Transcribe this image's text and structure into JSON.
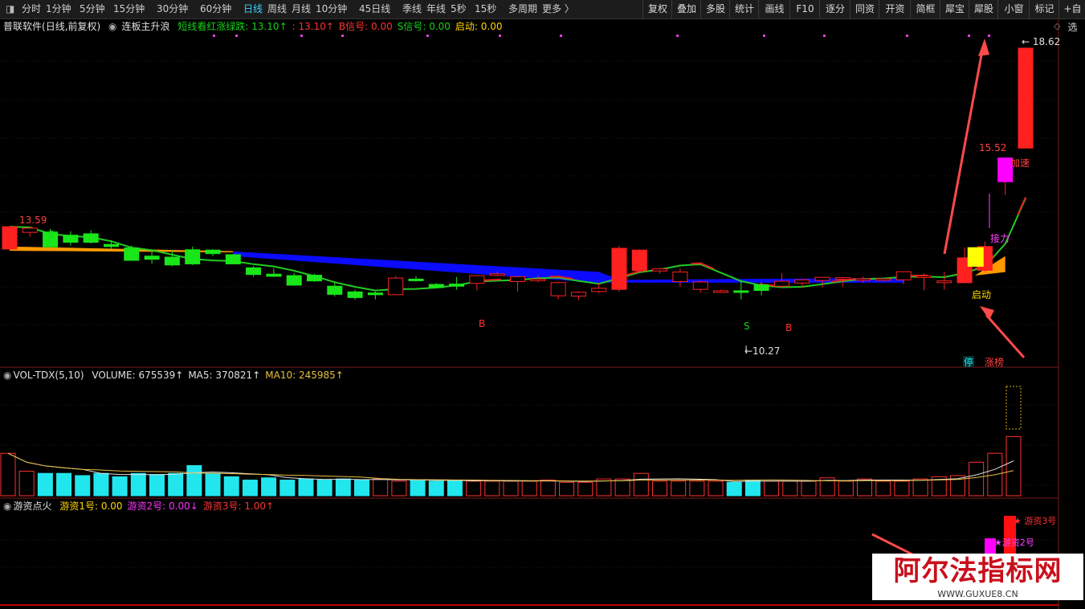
{
  "toolbar": {
    "periods": [
      "分时",
      "1分钟",
      "5分钟",
      "15分钟",
      "30分钟",
      "60分钟",
      "日线",
      "周线",
      "月线",
      "10分钟",
      "45日线",
      "季线",
      "年线",
      "5秒",
      "15秒",
      "多周期",
      "更多 〉"
    ],
    "active_period": "日线",
    "actions": [
      "复权",
      "叠加",
      "多股",
      "统计",
      "画线",
      "F10",
      "逐分",
      "同资",
      "开资",
      "简框",
      "犀宝",
      "犀股",
      "小窗",
      "标记",
      "+自选"
    ]
  },
  "main_panel": {
    "stock_name": "普联软件",
    "period_label": "(日线,前复权)",
    "indicator_name": "连板主升浪",
    "legend": [
      {
        "label": "短线看红涨绿跌:",
        "value": "13.10",
        "arrow": "↑",
        "color": "#19d219"
      },
      {
        "label": ":",
        "value": "13.10",
        "arrow": "↑",
        "color": "#ff3232"
      },
      {
        "label": "B信号:",
        "value": "0.00",
        "arrow": "",
        "color": "#ff3232"
      },
      {
        "label": "S信号:",
        "value": "0.00",
        "arrow": "",
        "color": "#19d219"
      },
      {
        "label": "启动:",
        "value": "0.00",
        "arrow": "",
        "color": "#ffd700"
      }
    ],
    "price_labels": {
      "high": "18.62",
      "mid": "15.52",
      "left": "13.59",
      "low": "10.27"
    },
    "annotations": {
      "jiasu": "加速",
      "jieli": "接力",
      "qidong": "启动",
      "ting": "停",
      "zhangbang": "涨榜",
      "buy": "B",
      "sell": "S"
    }
  },
  "volume_panel": {
    "name": "VOL-TDX(5,10)",
    "legend": [
      {
        "label": "VOLUME:",
        "value": "675539",
        "arrow": "↑",
        "color": "#e0e0e0"
      },
      {
        "label": "MA5:",
        "value": "370821",
        "arrow": "↑",
        "color": "#e0e0e0"
      },
      {
        "label": "MA10:",
        "value": "245985",
        "arrow": "↑",
        "color": "#e8c040"
      }
    ]
  },
  "youzi_panel": {
    "name": "游资点火",
    "legend": [
      {
        "label": "游资1号:",
        "value": "0.00",
        "arrow": "",
        "color": "#ffd700"
      },
      {
        "label": "游资2号:",
        "value": "0.00",
        "arrow": "↓",
        "color": "#ff33ff"
      },
      {
        "label": "游资3号:",
        "value": "1.00",
        "arrow": "↑",
        "color": "#ff3232"
      }
    ],
    "labels": {
      "youzi3": "★ 游资3号",
      "youzi2": "★游资2号"
    }
  },
  "watermark": {
    "main": "阿尔法指标网",
    "url": "WWW.GUXUE8.CN"
  },
  "colors": {
    "up": "#ff2020",
    "down": "#19e619",
    "ma_short": "#22cc22",
    "band_blue": "#0b0bff",
    "band_orange": "#ff9a00",
    "volume_down": "#22e6ee",
    "limit_up": "#ff00ff"
  },
  "chart_data": {
    "type": "candlestick",
    "candles": [
      {
        "o": 12.95,
        "h": 13.59,
        "l": 12.92,
        "c": 13.58
      },
      {
        "o": 13.42,
        "h": 13.59,
        "l": 13.3,
        "c": 13.54
      },
      {
        "o": 13.43,
        "h": 13.52,
        "l": 13.0,
        "c": 13.01
      },
      {
        "o": 13.34,
        "h": 13.45,
        "l": 13.05,
        "c": 13.14
      },
      {
        "o": 13.38,
        "h": 13.48,
        "l": 13.1,
        "c": 13.14
      },
      {
        "o": 13.08,
        "h": 13.2,
        "l": 12.95,
        "c": 13.02
      },
      {
        "o": 12.98,
        "h": 13.05,
        "l": 12.63,
        "c": 12.63
      },
      {
        "o": 12.75,
        "h": 12.92,
        "l": 12.54,
        "c": 12.66
      },
      {
        "o": 12.72,
        "h": 12.92,
        "l": 12.46,
        "c": 12.5
      },
      {
        "o": 12.93,
        "h": 13.02,
        "l": 12.5,
        "c": 12.53
      },
      {
        "o": 12.92,
        "h": 12.94,
        "l": 12.75,
        "c": 12.82
      },
      {
        "o": 12.79,
        "h": 12.81,
        "l": 12.52,
        "c": 12.53
      },
      {
        "o": 12.42,
        "h": 12.47,
        "l": 12.17,
        "c": 12.23
      },
      {
        "o": 12.24,
        "h": 12.4,
        "l": 12.16,
        "c": 12.18
      },
      {
        "o": 12.2,
        "h": 12.27,
        "l": 11.91,
        "c": 11.93
      },
      {
        "o": 12.21,
        "h": 12.25,
        "l": 12.02,
        "c": 12.05
      },
      {
        "o": 11.9,
        "h": 12.04,
        "l": 11.61,
        "c": 11.67
      },
      {
        "o": 11.74,
        "h": 11.8,
        "l": 11.52,
        "c": 11.58
      },
      {
        "o": 11.71,
        "h": 11.75,
        "l": 11.53,
        "c": 11.66
      },
      {
        "o": 11.66,
        "h": 12.19,
        "l": 11.65,
        "c": 12.13
      },
      {
        "o": 12.1,
        "h": 12.19,
        "l": 12.03,
        "c": 12.07
      },
      {
        "o": 11.95,
        "h": 11.99,
        "l": 11.84,
        "c": 11.86
      },
      {
        "o": 11.96,
        "h": 12.16,
        "l": 11.8,
        "c": 11.9
      },
      {
        "o": 11.98,
        "h": 12.03,
        "l": 11.78,
        "c": 12.2
      },
      {
        "o": 12.21,
        "h": 12.31,
        "l": 12.18,
        "c": 12.25
      },
      {
        "o": 12.03,
        "h": 12.2,
        "l": 11.75,
        "c": 12.17
      },
      {
        "o": 12.06,
        "h": 12.2,
        "l": 12.01,
        "c": 12.1
      },
      {
        "o": 11.63,
        "h": 12.03,
        "l": 11.53,
        "c": 12.0
      },
      {
        "o": 11.62,
        "h": 11.76,
        "l": 11.51,
        "c": 11.73
      },
      {
        "o": 11.75,
        "h": 11.99,
        "l": 11.7,
        "c": 11.84
      },
      {
        "o": 11.81,
        "h": 13.04,
        "l": 11.75,
        "c": 12.97
      },
      {
        "o": 12.34,
        "h": 12.94,
        "l": 12.33,
        "c": 12.92
      },
      {
        "o": 12.33,
        "h": 12.42,
        "l": 12.26,
        "c": 12.39
      },
      {
        "o": 12.03,
        "h": 12.4,
        "l": 11.88,
        "c": 12.3
      },
      {
        "o": 11.81,
        "h": 12.05,
        "l": 11.72,
        "c": 12.02
      },
      {
        "o": 11.76,
        "h": 11.8,
        "l": 11.71,
        "c": 11.77
      },
      {
        "o": 11.77,
        "h": 12.07,
        "l": 11.53,
        "c": 11.74
      },
      {
        "o": 11.94,
        "h": 12.01,
        "l": 11.64,
        "c": 11.78
      },
      {
        "o": 11.9,
        "h": 12.27,
        "l": 11.87,
        "c": 12.04
      },
      {
        "o": 11.99,
        "h": 12.1,
        "l": 11.85,
        "c": 12.08
      },
      {
        "o": 12.06,
        "h": 12.15,
        "l": 11.86,
        "c": 12.15
      },
      {
        "o": 12.11,
        "h": 12.17,
        "l": 11.89,
        "c": 12.14
      },
      {
        "o": 12.07,
        "h": 12.17,
        "l": 12.0,
        "c": 12.11
      },
      {
        "o": 12.08,
        "h": 12.12,
        "l": 12.04,
        "c": 12.11
      },
      {
        "o": 12.08,
        "h": 12.12,
        "l": 11.96,
        "c": 12.31
      },
      {
        "o": 12.17,
        "h": 12.26,
        "l": 11.78,
        "c": 12.19
      },
      {
        "o": 12.0,
        "h": 12.31,
        "l": 11.8,
        "c": 12.05
      },
      {
        "o": 12.0,
        "h": 12.99,
        "l": 11.98,
        "c": 12.7
      },
      {
        "o": 12.35,
        "h": 13.16,
        "l": 12.31,
        "c": 13.02
      },
      {
        "o": 14.85,
        "h": 15.52,
        "l": 14.48,
        "c": 15.52
      },
      {
        "o": 15.8,
        "h": 18.62,
        "l": 15.8,
        "c": 18.62
      }
    ],
    "volume": [
      0.38,
      0.22,
      0.2,
      0.2,
      0.18,
      0.2,
      0.17,
      0.2,
      0.19,
      0.2,
      0.27,
      0.2,
      0.17,
      0.14,
      0.16,
      0.14,
      0.15,
      0.14,
      0.15,
      0.14,
      0.15,
      0.13,
      0.14,
      0.13,
      0.14,
      0.13,
      0.13,
      0.13,
      0.13,
      0.14,
      0.12,
      0.12,
      0.15,
      0.15,
      0.2,
      0.13,
      0.13,
      0.13,
      0.13,
      0.12,
      0.14,
      0.13,
      0.13,
      0.13,
      0.16,
      0.13,
      0.15,
      0.13,
      0.13,
      0.15,
      0.17,
      0.18,
      0.3,
      0.38,
      0.53
    ],
    "volume_limit": 1.0,
    "ylim": [
      10.0,
      18.8
    ]
  }
}
